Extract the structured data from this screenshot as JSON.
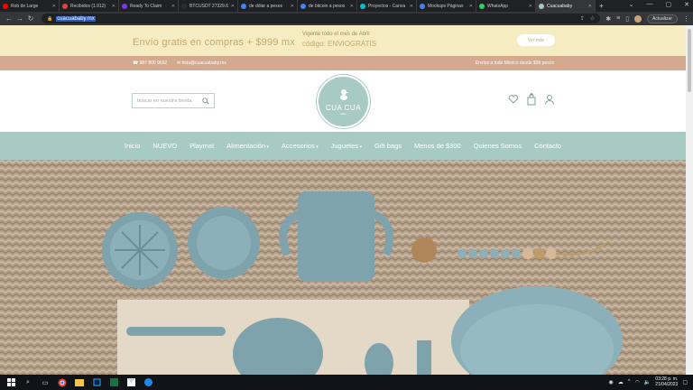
{
  "browser": {
    "tabs": [
      {
        "title": "Rob de Large",
        "color": "#ff0000",
        "active": false
      },
      {
        "title": "Recibidos (1.912)",
        "color": "#ea4335",
        "active": false
      },
      {
        "title": "Ready To Claim",
        "color": "#7c3aed",
        "active": false
      },
      {
        "title": "BTCUSDT 27329.6",
        "color": "#2a2e39",
        "active": false
      },
      {
        "title": "de dólar a pesos",
        "color": "#4285f4",
        "active": false
      },
      {
        "title": "de bitcoin a pesos",
        "color": "#4285f4",
        "active": false
      },
      {
        "title": "Proyectos - Canva",
        "color": "#00c4cc",
        "active": false
      },
      {
        "title": "Mockups Páginas",
        "color": "#4285f4",
        "active": false
      },
      {
        "title": "WhatsApp",
        "color": "#25d366",
        "active": false
      },
      {
        "title": "Cuacuababy",
        "color": "#a8cac5",
        "active": true
      }
    ],
    "url": "cuacuababy.mx",
    "update_label": "Actualizar"
  },
  "promo": {
    "free_shipping": "Envío gratis en compras + $999 mx",
    "valid_note": "Vigente todo el mes de Abril",
    "code_text": "código: ENVIOGRATIS",
    "button_label": "Ver más"
  },
  "contact": {
    "phone": "987 800 9692",
    "email": "hola@cuacuababy.mx",
    "shipping_note": "Envíos a todo México desde $99 pesos"
  },
  "header": {
    "search_placeholder": "buscar en nuestra tienda",
    "logo_text": "CUA CUA",
    "logo_sub": "baby"
  },
  "nav": {
    "items": [
      {
        "label": "Inicio"
      },
      {
        "label": "NUEVO"
      },
      {
        "label": "Playmat"
      },
      {
        "label": "Alimentación",
        "dropdown": true
      },
      {
        "label": "Accesorios",
        "dropdown": true
      },
      {
        "label": "Juguetes",
        "dropdown": true
      },
      {
        "label": "Gift bags"
      },
      {
        "label": "Menos de $300"
      },
      {
        "label": "Quienes Somos"
      },
      {
        "label": "Contacto"
      }
    ]
  },
  "colors": {
    "brand": "#a8cac5",
    "promo_bg": "#f5ecc2",
    "contact_bg": "#d4a98d",
    "gold_text": "#c4a96b"
  },
  "taskbar": {
    "time": "03:28 p. m.",
    "date": "21/04/2023"
  }
}
